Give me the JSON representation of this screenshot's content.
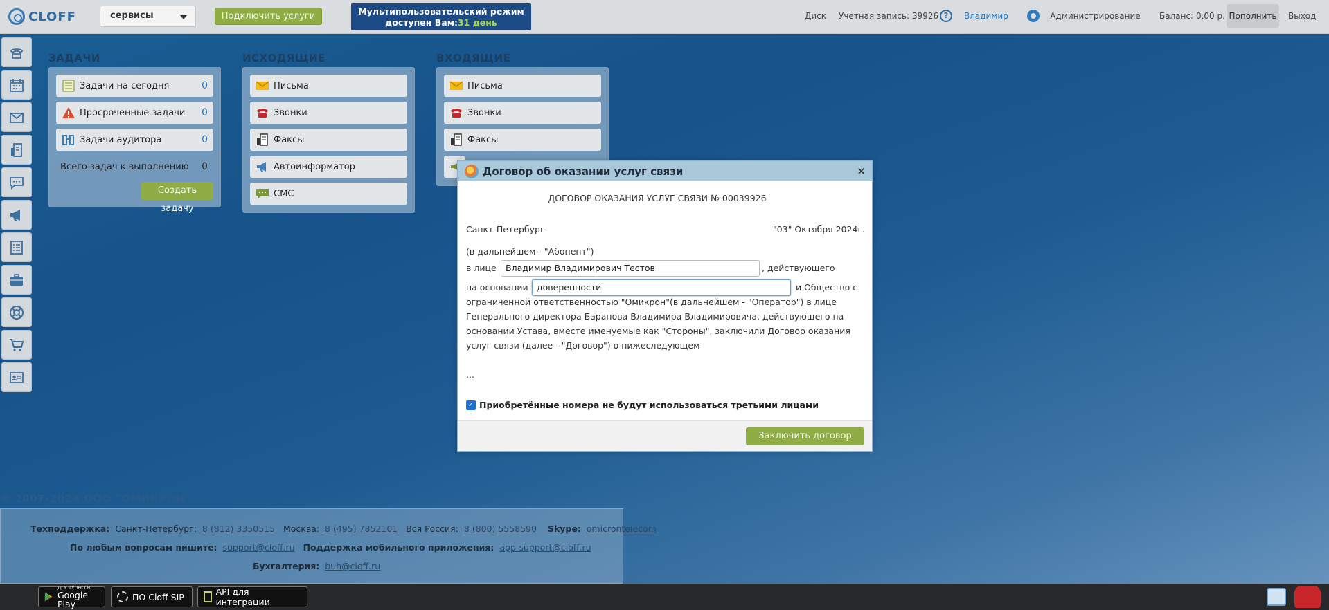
{
  "topbar": {
    "logo_text": "CLOFF",
    "service_select": "сервисы",
    "connect_button": "Подключить услуги",
    "multiuser_line1": "Мультипользовательский режим",
    "multiuser_line2": "доступен Вам:",
    "multiuser_days": "31 день",
    "disk": "Диск",
    "account_label": "Учетная запись:",
    "account_number": "39926",
    "user_name": "Владимир",
    "admin": "Администрирование",
    "balance_label": "Баланс:",
    "balance_value": "0.00 р.",
    "topup": "Пополнить",
    "logout": "Выход"
  },
  "tasks": {
    "title": "ЗАДАЧИ",
    "items": [
      {
        "label": "Задачи на сегодня",
        "count": "0"
      },
      {
        "label": "Просроченные задачи",
        "count": "0"
      },
      {
        "label": "Задачи аудитора",
        "count": "0"
      }
    ],
    "total_label": "Всего задач к выполнению",
    "total_count": "0",
    "create_button": "Создать задачу"
  },
  "outgoing": {
    "title": "ИСХОДЯЩИЕ",
    "items": [
      "Письма",
      "Звонки",
      "Факсы",
      "Автоинформатор",
      "СМС"
    ]
  },
  "incoming": {
    "title": "ВХОДЯЩИЕ",
    "items": [
      "Письма",
      "Звонки",
      "Факсы"
    ]
  },
  "modal": {
    "title": "Договор об оказании услуг связи",
    "close": "×",
    "heading": "ДОГОВОР ОКАЗАНИЯ УСЛУГ СВЯЗИ № 00039926",
    "city": "Санкт-Петербург",
    "date": "\"03\" Октября 2024г.",
    "subscriber_note": "(в дальнейшем - \"Абонент\")",
    "person_label": "в лице",
    "person_value": "Владимир Владимирович Тестов",
    "acting_text": ", действующего",
    "basis_label": "на основании",
    "basis_value": "доверенности",
    "basis_after": "и Общество с",
    "paragraph": "ограниченной ответственностью \"Омикрон\"(в дальнейшем - \"Оператор\") в лице Генерального директора Баранова Владимира Владимировича, действующего на основании Устава, вместе именуемые как \"Стороны\", заключили Договор оказания услуг связи (далее - \"Договор\") о нижеследующем",
    "ellipsis": "...",
    "checkbox_label": "Приобретённые номера не будут использоваться третьими лицами",
    "checkbox_checked": true,
    "sign_button": "Заключить договор"
  },
  "footer": {
    "company": "© 2007-2024 ООО \"ОМИКРОН\"",
    "support_label": "Техподдержка:",
    "spb_label": "Санкт-Петербург:",
    "spb_phone": "8 (812) 3350515",
    "msk_label": "Москва:",
    "msk_phone": "8 (495) 7852101",
    "russia_label": "Вся Россия:",
    "russia_phone": "8 (800) 5558590",
    "skype_label": "Skype:",
    "skype_value": "omicrontelecom",
    "questions_label": "По любым вопросам пишите:",
    "support_email": "support@cloff.ru",
    "mobile_label": "Поддержка мобильного приложения:",
    "mobile_email": "app-support@cloff.ru",
    "accounting_label": "Бухгалтерия:",
    "accounting_email": "buh@cloff.ru"
  },
  "bottombar": {
    "gp_small": "ДОСТУПНО В",
    "gp_big": "Google Play",
    "sip": "ПО Cloff SIP",
    "api": "API для интеграции"
  }
}
